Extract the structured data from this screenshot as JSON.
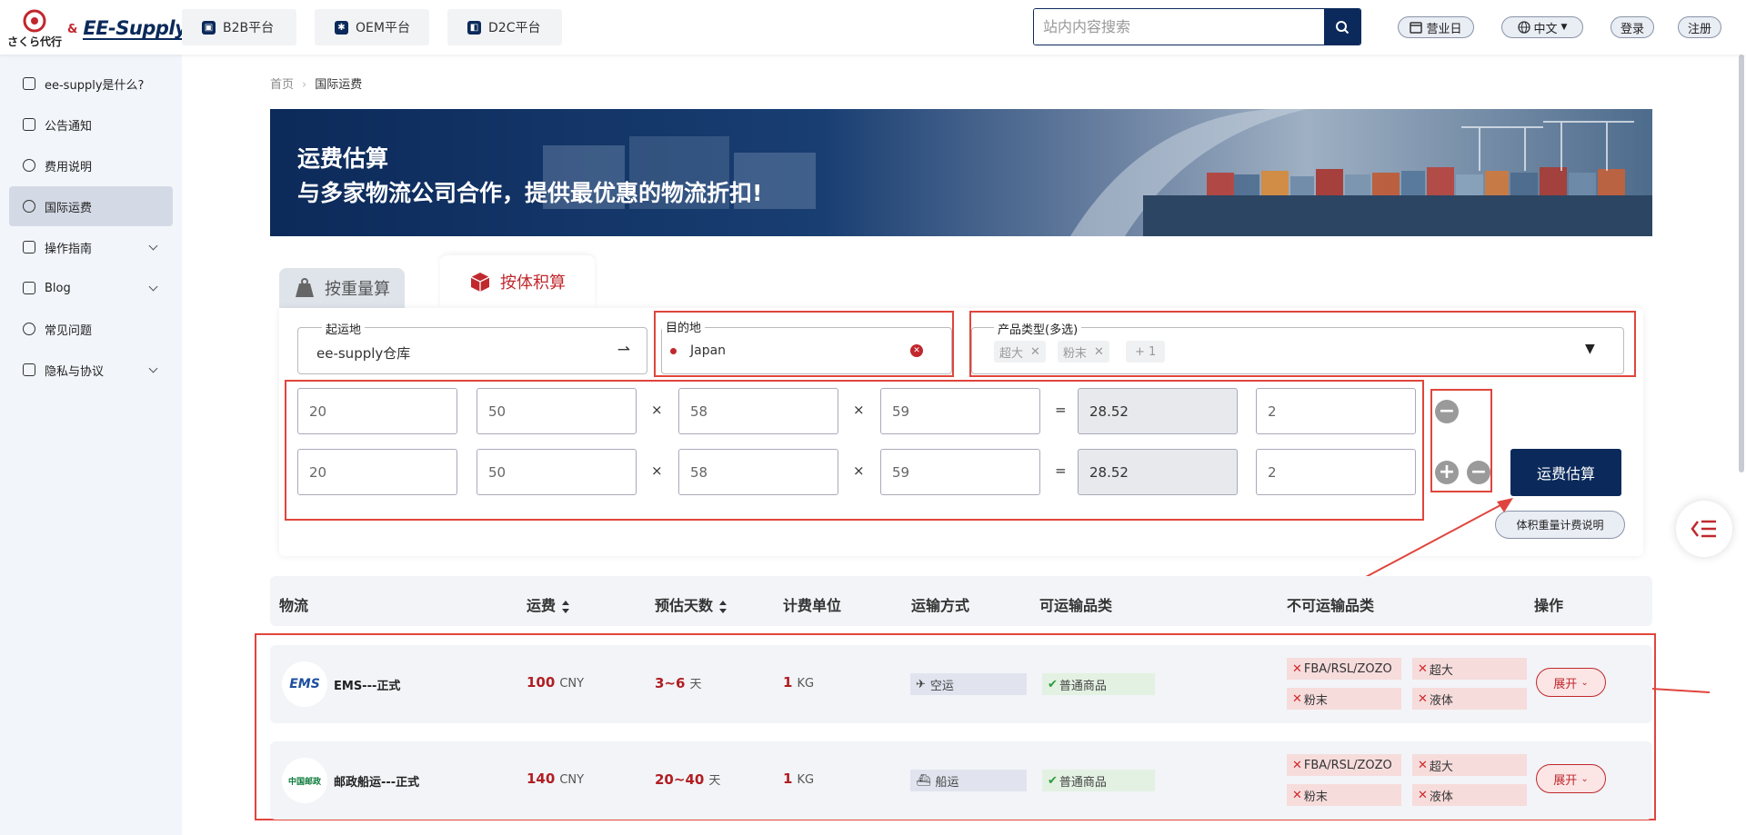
{
  "header": {
    "logo_text": "さくら代行",
    "logo_amp": "&",
    "logo_brand": "EE-Supply",
    "platforms": [
      "B2B平台",
      "OEM平台",
      "D2C平台"
    ],
    "search_placeholder": "站内内容搜索",
    "business_day": "营业日",
    "language": "中文",
    "login": "登录",
    "register": "注册"
  },
  "sidebar": {
    "items": [
      {
        "label": "ee-supply是什么?",
        "icon": "home-icon"
      },
      {
        "label": "公告通知",
        "icon": "megaphone-icon"
      },
      {
        "label": "费用说明",
        "icon": "yen-icon"
      },
      {
        "label": "国际运费",
        "icon": "globe-icon"
      },
      {
        "label": "操作指南",
        "icon": "guide-icon"
      },
      {
        "label": "Blog",
        "icon": "image-icon"
      },
      {
        "label": "常见问题",
        "icon": "heart-icon"
      },
      {
        "label": "隐私与协议",
        "icon": "document-icon"
      }
    ]
  },
  "breadcrumb": {
    "home": "首页",
    "current": "国际运费"
  },
  "banner": {
    "title": "运费估算",
    "subtitle": "与多家物流公司合作，提供最优惠的物流折扣!"
  },
  "tabs": {
    "weight": "按重量算",
    "volume": "按体积算"
  },
  "form": {
    "origin_label": "起运地",
    "origin_value": "ee-supply仓库",
    "dest_label": "目的地",
    "dest_value": "Japan",
    "product_label": "产品类型(多选)",
    "product_tags": [
      "超大",
      "粉末"
    ],
    "product_more": "+ 1",
    "rows": [
      {
        "weight": "20",
        "length": "50",
        "width": "58",
        "height": "59",
        "volume": "28.52",
        "qty": "2"
      },
      {
        "weight": "20",
        "length": "50",
        "width": "58",
        "height": "59",
        "volume": "28.52",
        "qty": "2"
      }
    ],
    "times": "×",
    "equals": "=",
    "calc_button": "运费估算",
    "note_button": "体积重量计费说明"
  },
  "table": {
    "headers": [
      "物流",
      "运费",
      "预估天数",
      "计费单位",
      "运输方式",
      "可运输品类",
      "不可运输品类",
      "操作"
    ],
    "rows": [
      {
        "name": "EMS---正式",
        "logo": "EMS",
        "fee": "100",
        "fee_unit": "CNY",
        "days": "3~6",
        "days_unit": "天",
        "unit_num": "1",
        "unit": "KG",
        "transport": "空运",
        "allowed": "普通商品",
        "forbidden": [
          "FBA/RSL/ZOZO",
          "超大",
          "粉末",
          "液体"
        ],
        "action": "展开"
      },
      {
        "name": "邮政船运---正式",
        "logo": "中国邮政",
        "fee": "140",
        "fee_unit": "CNY",
        "days": "20~40",
        "days_unit": "天",
        "unit_num": "1",
        "unit": "KG",
        "transport": "船运",
        "allowed": "普通商品",
        "forbidden": [
          "FBA/RSL/ZOZO",
          "超大",
          "粉末",
          "液体"
        ],
        "action": "展开"
      }
    ]
  },
  "colors": {
    "navy": "#0b2a5b",
    "accent_red": "#c0282d",
    "annotation_red": "#e0453d"
  }
}
